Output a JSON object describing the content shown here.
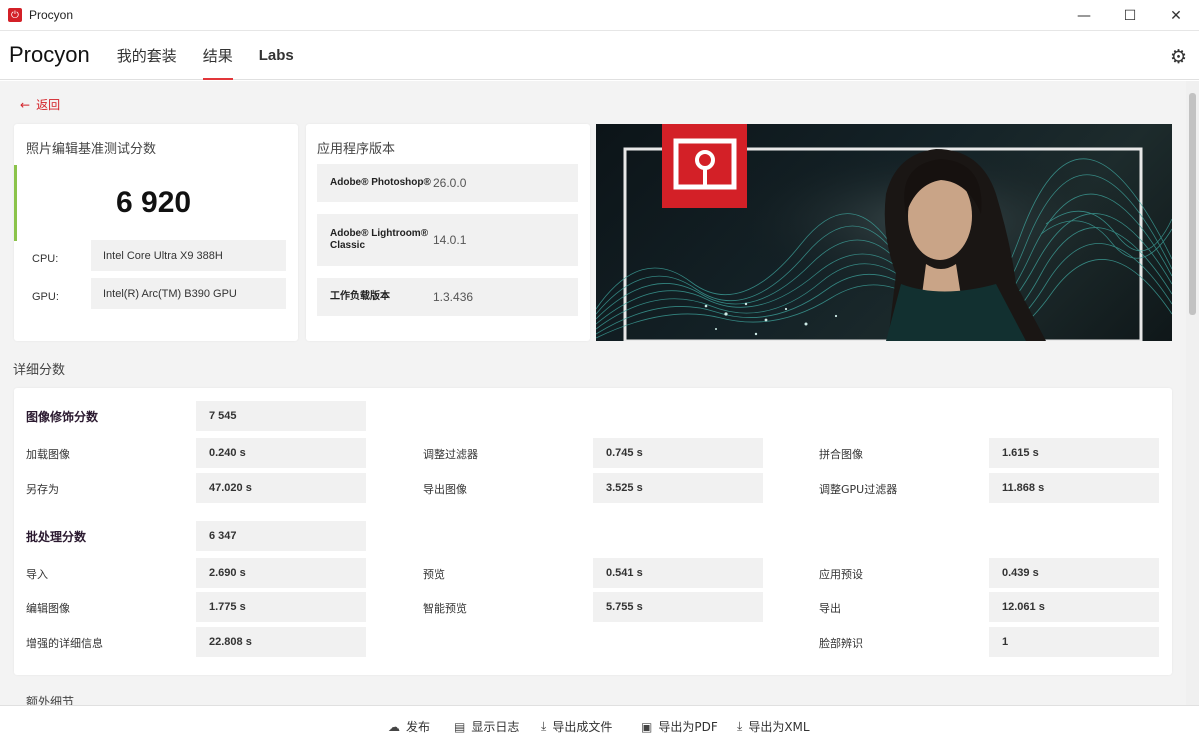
{
  "window": {
    "title": "Procyon",
    "minimize": "—",
    "maximize": "☐",
    "close": "✕"
  },
  "nav": {
    "brand": "Procyon",
    "tabs": [
      "我的套装",
      "结果",
      "Labs"
    ],
    "active_tab": "结果"
  },
  "back_label": "返回",
  "summary": {
    "title": "照片编辑基准测试分数",
    "score": "6 920",
    "cpu_label": "CPU:",
    "cpu_value": "Intel Core Ultra X9 388H",
    "gpu_label": "GPU:",
    "gpu_value": "Intel(R) Arc(TM) B390 GPU"
  },
  "versions": {
    "title": "应用程序版本",
    "rows": [
      {
        "name": "Adobe® Photoshop®",
        "value": "26.0.0"
      },
      {
        "name": "Adobe® Lightroom® Classic",
        "value": "14.0.1"
      },
      {
        "name": "工作负载版本",
        "value": "1.3.436"
      }
    ]
  },
  "details": {
    "title": "详细分数",
    "retouch": {
      "label": "图像修饰分数",
      "value": "7 545",
      "items": [
        {
          "label": "加载图像",
          "value": "0.240 s"
        },
        {
          "label": "调整过滤器",
          "value": "0.745 s"
        },
        {
          "label": "拼合图像",
          "value": "1.615 s"
        },
        {
          "label": "另存为",
          "value": "47.020 s"
        },
        {
          "label": "导出图像",
          "value": "3.525 s"
        },
        {
          "label": "调整GPU过滤器",
          "value": "11.868 s"
        }
      ]
    },
    "batch": {
      "label": "批处理分数",
      "value": "6 347",
      "items": [
        {
          "label": "导入",
          "value": "2.690 s"
        },
        {
          "label": "预览",
          "value": "0.541 s"
        },
        {
          "label": "应用预设",
          "value": "0.439 s"
        },
        {
          "label": "编辑图像",
          "value": "1.775 s"
        },
        {
          "label": "智能预览",
          "value": "5.755 s"
        },
        {
          "label": "导出",
          "value": "12.061 s"
        },
        {
          "label": "增强的详细信息",
          "value": "22.808 s"
        },
        {
          "label": "脸部辨识",
          "value": "1"
        }
      ]
    }
  },
  "extra_title": "额外细节",
  "toolbar": {
    "publish": "发布",
    "show_log": "显示日志",
    "export_file": "导出成文件",
    "export_pdf": "导出为PDF",
    "export_xml": "导出为XML"
  },
  "colors": {
    "accent_red": "#d32027",
    "score_bar": "#8bc34a"
  }
}
